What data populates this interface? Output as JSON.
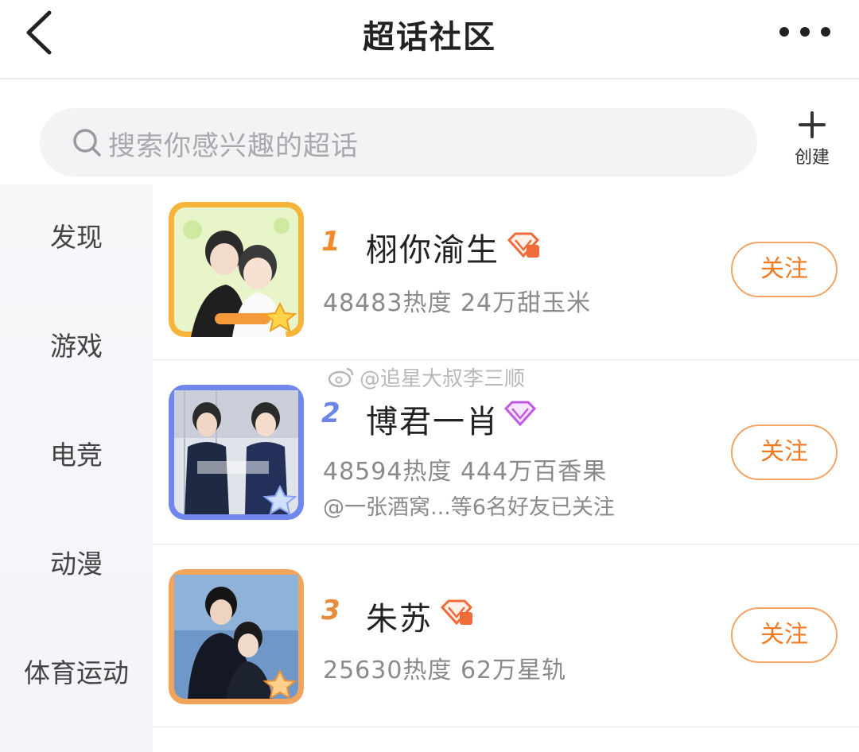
{
  "header": {
    "title": "超话社区"
  },
  "search": {
    "placeholder": "搜索你感兴趣的超话"
  },
  "create": {
    "label": "创建"
  },
  "sidebar": {
    "items": [
      {
        "label": "发现"
      },
      {
        "label": "游戏"
      },
      {
        "label": "电竞"
      },
      {
        "label": "动漫"
      },
      {
        "label": "体育运动"
      }
    ]
  },
  "list": [
    {
      "rank": "1",
      "name": "栩你渝生",
      "stats": "48483热度 24万甜玉米",
      "friends": "",
      "follow_label": "关注"
    },
    {
      "rank": "2",
      "name": "博君一肖",
      "stats": "48594热度 444万百香果",
      "friends": "@一张酒窝...等6名好友已关注",
      "follow_label": "关注"
    },
    {
      "rank": "3",
      "name": "朱苏",
      "stats": "25630热度 62万星轨",
      "friends": "",
      "follow_label": "关注"
    }
  ],
  "watermark": {
    "text": "@追星大叔李三顺"
  },
  "colors": {
    "accent": "#f07a22",
    "rank1": "#f08a2c",
    "rank2": "#6b86e8",
    "rank3": "#e88b3a",
    "badge_orange": "#f06a3a",
    "badge_purple": "#c158e6"
  }
}
